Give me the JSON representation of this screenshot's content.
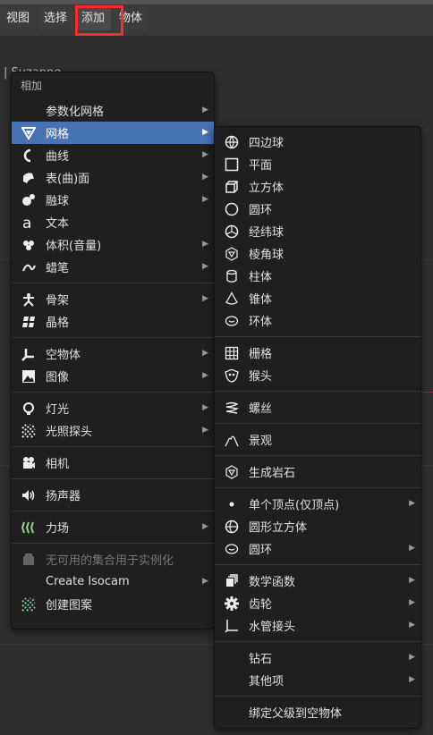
{
  "header": {
    "menu_items": [
      "视图",
      "选择",
      "添加",
      "物体"
    ],
    "highlighted": "添加",
    "highlight_color": "#ff2a2a"
  },
  "viewport": {
    "object_label": "Suzanne"
  },
  "add_menu": {
    "title": "相加",
    "selected_color": "#4772b3",
    "groups": [
      [
        {
          "label": "参数化网格",
          "icon": "none",
          "submenu": true
        },
        {
          "label": "网格",
          "icon": "mesh-icon",
          "submenu": true,
          "selected": true
        },
        {
          "label": "曲线",
          "icon": "curve-icon",
          "submenu": true
        },
        {
          "label": "表(曲)面",
          "icon": "surface-icon",
          "submenu": true
        },
        {
          "label": "融球",
          "icon": "metaball-icon",
          "submenu": true
        },
        {
          "label": "文本",
          "icon": "text-icon",
          "submenu": false
        },
        {
          "label": "体积(音量)",
          "icon": "volume-icon",
          "submenu": true
        },
        {
          "label": "蜡笔",
          "icon": "grease-pencil-icon",
          "submenu": true
        }
      ],
      [
        {
          "label": "骨架",
          "icon": "armature-icon",
          "submenu": true
        },
        {
          "label": "晶格",
          "icon": "lattice-icon",
          "submenu": false
        }
      ],
      [
        {
          "label": "空物体",
          "icon": "empty-icon",
          "submenu": true
        },
        {
          "label": "图像",
          "icon": "image-icon",
          "submenu": true
        }
      ],
      [
        {
          "label": "灯光",
          "icon": "light-icon",
          "submenu": true
        },
        {
          "label": "光照探头",
          "icon": "light-probe-icon",
          "submenu": true
        }
      ],
      [
        {
          "label": "相机",
          "icon": "camera-icon",
          "submenu": false
        }
      ],
      [
        {
          "label": "扬声器",
          "icon": "speaker-icon",
          "submenu": false
        }
      ],
      [
        {
          "label": "力场",
          "icon": "force-field-icon",
          "submenu": true
        }
      ],
      [
        {
          "label": "无可用的集合用于实例化",
          "icon": "collection-icon",
          "submenu": false,
          "disabled": true
        },
        {
          "label": "Create Isocam",
          "icon": "none",
          "submenu": true,
          "underline_first": true
        },
        {
          "label": "创建图案",
          "icon": "pattern-icon",
          "submenu": false
        }
      ]
    ]
  },
  "mesh_menu": {
    "groups": [
      [
        {
          "label": "四边球",
          "icon": "uv-sphere-icon"
        },
        {
          "label": "平面",
          "icon": "plane-icon"
        },
        {
          "label": "立方体",
          "icon": "cube-icon"
        },
        {
          "label": "圆环",
          "icon": "circle-icon"
        },
        {
          "label": "经纬球",
          "icon": "globe-icon"
        },
        {
          "label": "棱角球",
          "icon": "ico-sphere-icon"
        },
        {
          "label": "柱体",
          "icon": "cylinder-icon"
        },
        {
          "label": "锥体",
          "icon": "cone-icon"
        },
        {
          "label": "环体",
          "icon": "torus-icon"
        }
      ],
      [
        {
          "label": "栅格",
          "icon": "grid-icon"
        },
        {
          "label": "猴头",
          "icon": "monkey-icon"
        }
      ],
      [
        {
          "label": "螺丝",
          "icon": "screw-icon"
        }
      ],
      [
        {
          "label": "景观",
          "icon": "landscape-icon"
        }
      ],
      [
        {
          "label": "生成岩石",
          "icon": "rock-icon"
        }
      ],
      [
        {
          "label": "单个顶点(仅顶点)",
          "icon": "vertex-icon",
          "submenu": true
        },
        {
          "label": "圆形立方体",
          "icon": "round-cube-icon"
        },
        {
          "label": "圆环",
          "icon": "torus-icon",
          "submenu": true
        }
      ],
      [
        {
          "label": "数学函数",
          "icon": "math-function-icon",
          "submenu": true
        },
        {
          "label": "齿轮",
          "icon": "gear-icon",
          "submenu": true
        },
        {
          "label": "水管接头",
          "icon": "pipe-joint-icon",
          "submenu": true
        }
      ],
      [
        {
          "label": "钻石",
          "icon": "none",
          "submenu": true
        },
        {
          "label": "其他项",
          "icon": "none",
          "submenu": true
        }
      ],
      [
        {
          "label": "绑定父级到空物体",
          "icon": "none"
        }
      ]
    ]
  }
}
